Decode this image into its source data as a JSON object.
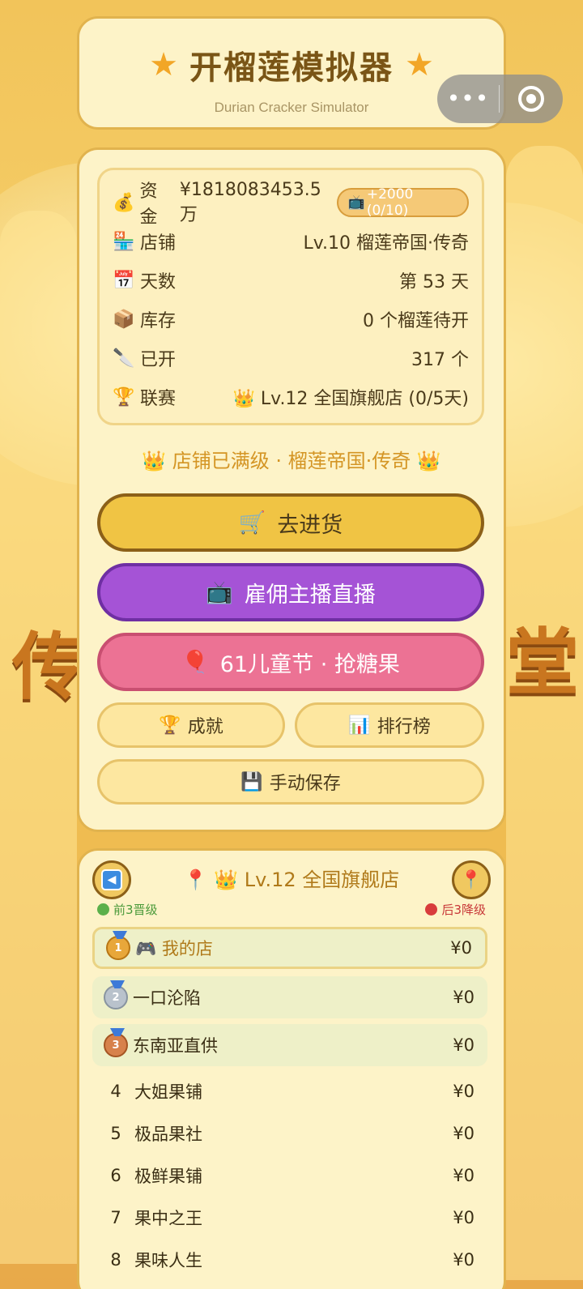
{
  "header": {
    "title": "开榴莲模拟器",
    "subtitle": "Durian Cracker Simulator"
  },
  "stats": {
    "fund": {
      "icon": "💰",
      "label": "资金",
      "value": "¥1818083453.5万",
      "ad_icon": "📺",
      "ad_label": "+2000 (0/10)"
    },
    "shop": {
      "icon": "🏪",
      "label": "店铺",
      "value": "Lv.10 榴莲帝国·传奇"
    },
    "days": {
      "icon": "📅",
      "label": "天数",
      "value": "第 53 天"
    },
    "stock": {
      "icon": "📦",
      "label": "库存",
      "value": "0 个榴莲待开"
    },
    "opened": {
      "icon": "🔪",
      "label": "已开",
      "value": "317 个"
    },
    "league": {
      "icon": "🏆",
      "label": "联赛",
      "value": "👑 Lv.12 全国旗舰店 (0/5天)"
    }
  },
  "banner": "👑 店铺已满级 · 榴莲帝国·传奇 👑",
  "buttons": {
    "restock": {
      "icon": "🛒",
      "label": "去进货"
    },
    "stream": {
      "icon": "📺",
      "label": "雇佣主播直播"
    },
    "candy": {
      "icon": "🎈",
      "label": "61儿童节 · 抢糖果"
    },
    "achievements": {
      "icon": "🏆",
      "label": "成就"
    },
    "leaderboard": {
      "icon": "📊",
      "label": "排行榜"
    },
    "save": {
      "icon": "💾",
      "label": "手动保存"
    }
  },
  "league_panel": {
    "title": "📍 👑 Lv.12 全国旗舰店",
    "promote_legend": "前3晋级",
    "demote_legend": "后3降级",
    "rows": [
      {
        "rank": "1",
        "name": "🎮 我的店",
        "value": "¥0"
      },
      {
        "rank": "2",
        "name": "一口沦陷",
        "value": "¥0"
      },
      {
        "rank": "3",
        "name": "东南亚直供",
        "value": "¥0"
      },
      {
        "rank": "4",
        "name": "大姐果铺",
        "value": "¥0"
      },
      {
        "rank": "5",
        "name": "极品果社",
        "value": "¥0"
      },
      {
        "rank": "6",
        "name": "极鲜果铺",
        "value": "¥0"
      },
      {
        "rank": "7",
        "name": "果中之王",
        "value": "¥0"
      },
      {
        "rank": "8",
        "name": "果味人生",
        "value": "¥0"
      }
    ]
  },
  "colors": {
    "card_bg": "#fdf3c8",
    "card_border": "#e1b34e",
    "restock": "#f0c444",
    "stream": "#a553d6",
    "candy": "#ec7294",
    "promote": "#5bb04a",
    "demote": "#d83c3c"
  }
}
